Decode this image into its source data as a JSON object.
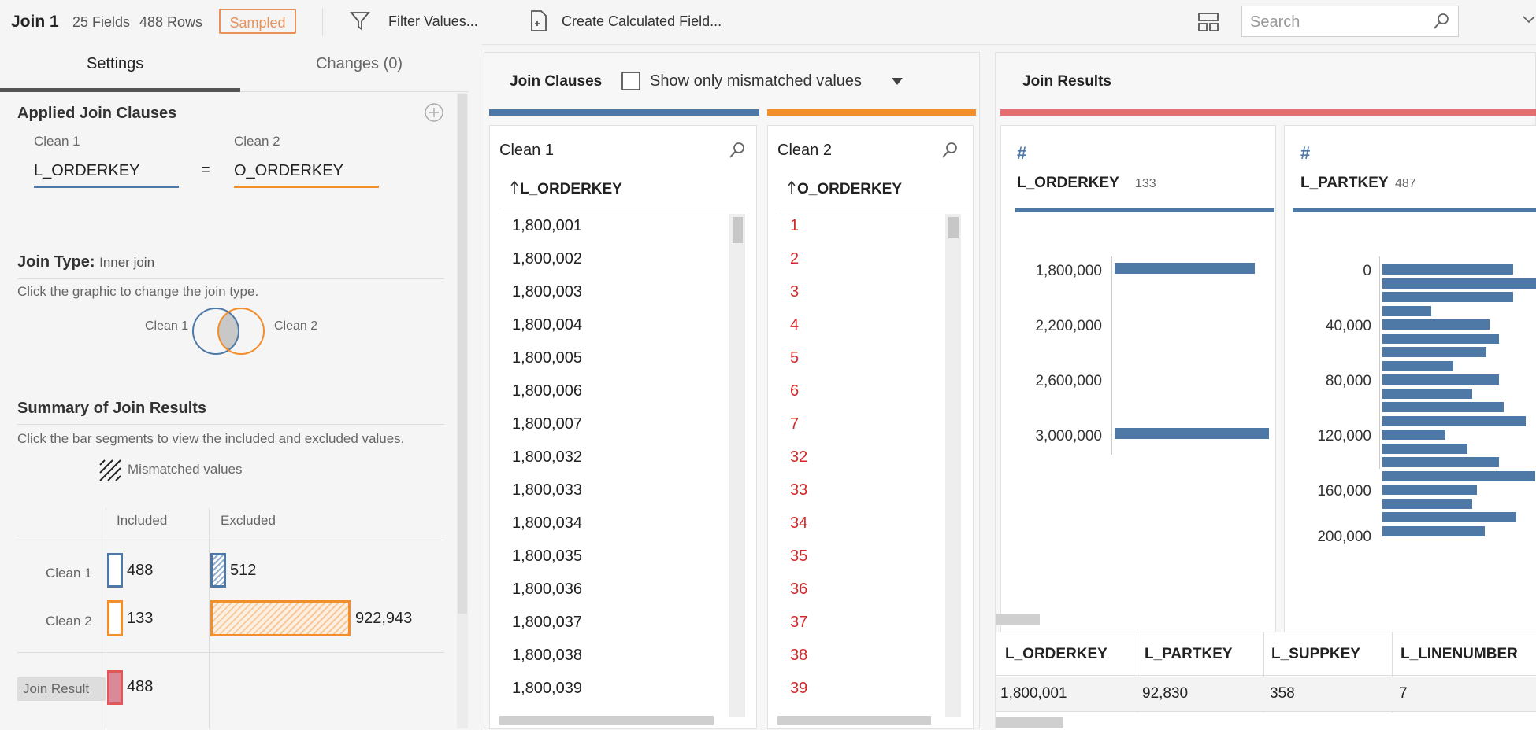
{
  "topbar": {
    "title": "Join 1",
    "fields": "25 Fields",
    "rows": "488 Rows",
    "sampled": "Sampled",
    "filter_label": "Filter Values...",
    "calc_label": "Create Calculated Field...",
    "search_placeholder": "Search"
  },
  "tabs": {
    "settings": "Settings",
    "changes": "Changes (0)"
  },
  "applied": {
    "title": "Applied Join Clauses",
    "left_source": "Clean 1",
    "right_source": "Clean 2",
    "left_field": "L_ORDERKEY",
    "operator": "=",
    "right_field": "O_ORDERKEY"
  },
  "join_type": {
    "label": "Join Type:",
    "value": "Inner join",
    "hint": "Click the graphic to change the join type.",
    "left": "Clean 1",
    "right": "Clean 2"
  },
  "summary": {
    "title": "Summary of Join Results",
    "hint": "Click the bar segments to view the included and excluded values.",
    "mismatch_label": "Mismatched values",
    "included_header": "Included",
    "excluded_header": "Excluded",
    "rows": [
      {
        "label": "Clean 1",
        "included": "488",
        "excluded": "512"
      },
      {
        "label": "Clean 2",
        "included": "133",
        "excluded": "922,943"
      }
    ],
    "result_label": "Join Result",
    "result_value": "488"
  },
  "join_clauses": {
    "title": "Join Clauses",
    "mismatch_checkbox": "Show only mismatched values",
    "left_card": {
      "source": "Clean 1",
      "field": "L_ORDERKEY",
      "values": [
        "1,800,001",
        "1,800,002",
        "1,800,003",
        "1,800,004",
        "1,800,005",
        "1,800,006",
        "1,800,007",
        "1,800,032",
        "1,800,033",
        "1,800,034",
        "1,800,035",
        "1,800,036",
        "1,800,037",
        "1,800,038",
        "1,800,039"
      ]
    },
    "right_card": {
      "source": "Clean 2",
      "field": "O_ORDERKEY",
      "values": [
        "1",
        "2",
        "3",
        "4",
        "5",
        "6",
        "7",
        "32",
        "33",
        "34",
        "35",
        "36",
        "37",
        "38",
        "39"
      ]
    }
  },
  "join_results": {
    "title": "Join Results",
    "profile1": {
      "field": "L_ORDERKEY",
      "count": "133",
      "ticks": [
        "1,800,000",
        "2,200,000",
        "2,600,000",
        "3,000,000"
      ]
    },
    "profile2": {
      "field": "L_PARTKEY",
      "count": "487",
      "ticks": [
        "0",
        "40,000",
        "80,000",
        "120,000",
        "160,000",
        "200,000"
      ]
    },
    "columns": [
      "L_ORDERKEY",
      "L_PARTKEY",
      "L_SUPPKEY",
      "L_LINENUMBER"
    ],
    "row": [
      "1,800,001",
      "92,830",
      "358",
      "7"
    ]
  },
  "colors": {
    "clean1": "#4e79a7",
    "clean2": "#f28e2b",
    "result": "#e15759",
    "mismatch_text": "#d62728"
  }
}
